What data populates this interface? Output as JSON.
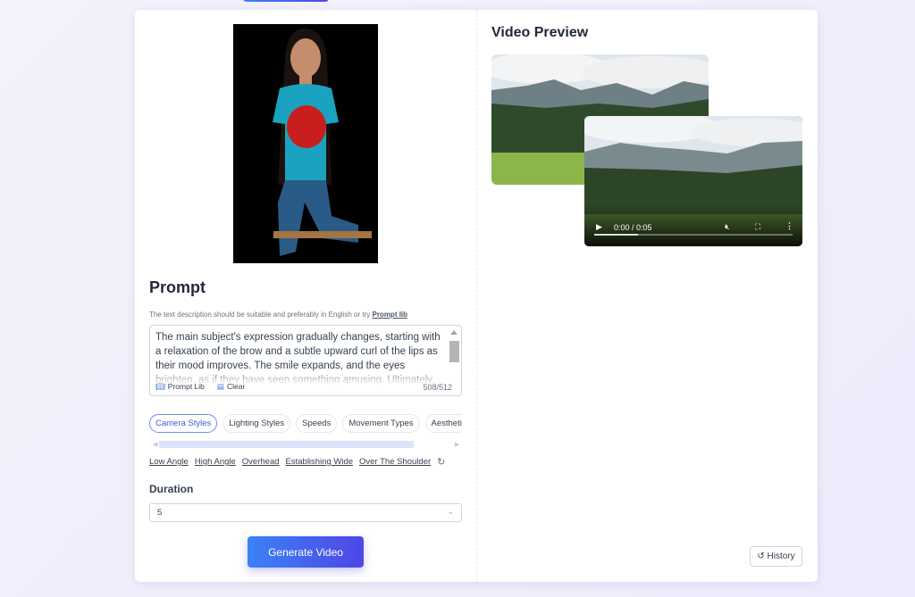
{
  "prompt": {
    "title": "Prompt",
    "hint": "The text description should be suitable and preferably in English or try",
    "hint_link": "Prompt lib",
    "text": "The main subject's expression gradually changes, starting with a relaxation of the brow and a subtle upward curl of the lips as their mood improves. The smile expands, and the eyes brighten, as if they have seen something amusing. Ultimately, the subject bursts into a big laugh, mouth wide open to reveal bright white teeth",
    "prompt_lib_label": "Prompt Lib",
    "clear_label": "Clear",
    "char_count": "508/512"
  },
  "style_tabs": [
    {
      "label": "Camera Styles",
      "active": true
    },
    {
      "label": "Lighting Styles"
    },
    {
      "label": "Speeds"
    },
    {
      "label": "Movement Types"
    },
    {
      "label": "Aesthetic"
    },
    {
      "label": ""
    }
  ],
  "style_options": [
    "Low Angle",
    "High Angle",
    "Overhead",
    "Establishing Wide",
    "Over The Shoulder"
  ],
  "duration": {
    "label": "Duration",
    "value": "5"
  },
  "generate_label": "Generate Video",
  "preview": {
    "title": "Video Preview",
    "time": "0:00 / 0:05",
    "progress_percent": 22
  },
  "history_label": "History",
  "colors": {
    "accent": "#4f46e5",
    "accent_start": "#3b82f6"
  }
}
